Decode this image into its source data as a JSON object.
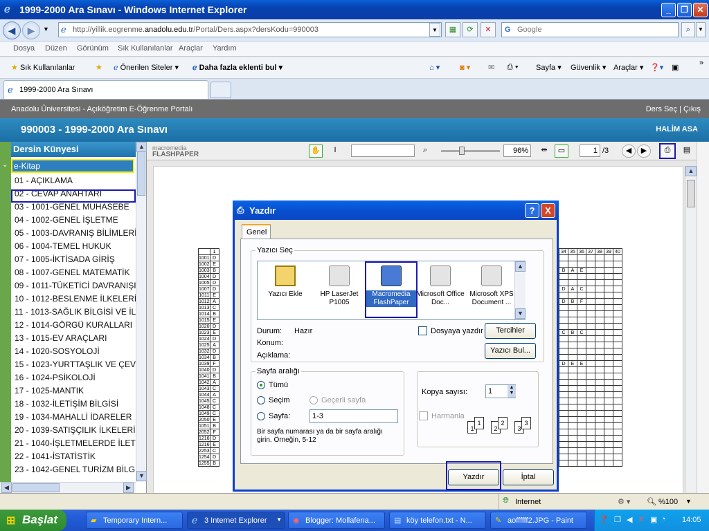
{
  "window": {
    "title": "1999-2000 Ara Sınavı - Windows Internet Explorer"
  },
  "address": {
    "url_prefix": "http://yillik.eogrenme.",
    "url_domain": "anadolu.edu.tr",
    "url_suffix": "/Portal/Ders.aspx?dersKodu=990003",
    "search_placeholder": "Google"
  },
  "menu": [
    "Dosya",
    "Düzen",
    "Görünüm",
    "Sık Kullanılanlar",
    "Araçlar",
    "Yardım"
  ],
  "favbar": {
    "favorites": "Sık Kullanılanlar",
    "suggested": "Önerilen Siteler",
    "addons": "Daha fazla eklenti bul",
    "page": "Sayfa",
    "security": "Güvenlik",
    "tools": "Araçlar"
  },
  "tabs": [
    {
      "label": "1999-2000 Ara Sınavı"
    }
  ],
  "portal": {
    "title": "Anadolu Üniversitesi - Açıköğretim E-Öğrenme Portalı",
    "links": "Ders Seç | Çıkış",
    "course_title": "990003 - 1999-2000 Ara Sınavı",
    "user": "HALİM ASA"
  },
  "sidebar": {
    "header": "Dersin Künyesi",
    "ekitap": "e-Kitap",
    "items": [
      "01 - AÇIKLAMA",
      "02 - CEVAP ANAHTARI",
      "03 - 1001-GENEL MUHASEBE",
      "04 - 1002-GENEL İŞLETME",
      "05 - 1003-DAVRANIŞ BİLİMLERİ",
      "06 - 1004-TEMEL HUKUK",
      "07 - 1005-İKTİSADA GİRİŞ",
      "08 - 1007-GENEL MATEMATİK",
      "09 - 1011-TÜKETİCİ DAVRANIŞI",
      "10 - 1012-BESLENME İLKELERİ",
      "11 - 1013-SAĞLIK BİLGİSİ VE İL",
      "12 - 1014-GÖRGÜ KURALLARI",
      "13 - 1015-EV ARAÇLARI",
      "14 - 1020-SOSYOLOJİ",
      "15 - 1023-YURTTAŞLIK VE ÇEV",
      "16 - 1024-PSİKOLOJİ",
      "17 - 1025-MANTIK",
      "18 - 1032-İLETİŞİM BİLGİSİ",
      "19 - 1034-MAHALLİ İDARELER",
      "20 - 1039-SATIŞÇILIK İLKELERİ",
      "21 - 1040-İŞLETMELERDE İLET",
      "22 - 1041-İSTATİSTİK",
      "23 - 1042-GENEL TURİZM BİLG"
    ]
  },
  "flashpaper": {
    "logo_top": "macromedia",
    "logo_bottom": "FLASHPAPER",
    "zoom": "96%",
    "page": "1",
    "pages": "/3"
  },
  "doc": {
    "header_cols": [
      "34",
      "35",
      "36",
      "37",
      "38",
      "39",
      "40"
    ],
    "row_codes": [
      "1001",
      "1002",
      "1003",
      "1004",
      "1005",
      "1007",
      "1011",
      "1012",
      "1013",
      "1014",
      "1015",
      "1020",
      "1023",
      "1024",
      "1025",
      "1032",
      "1034",
      "1039",
      "1040",
      "1041",
      "1042",
      "1043",
      "1044",
      "1045",
      "1048",
      "1049",
      "2050",
      "1051",
      "2052",
      "1216",
      "1216",
      "2253",
      "1254",
      "1255"
    ],
    "row_keys": [
      "D",
      "E",
      "B",
      "D",
      "D",
      "D",
      "E",
      "A",
      "C",
      "B",
      "E",
      "D",
      "E",
      "D",
      "A",
      "D",
      "B",
      "F",
      "D",
      "B",
      "A",
      "C",
      "A",
      "C",
      "C",
      "C",
      "E",
      "B",
      "F",
      "D",
      "E",
      "C",
      "D",
      "B"
    ],
    "answers_right": [
      [
        "B",
        "A",
        "E"
      ],
      [
        "D",
        "A",
        "C"
      ],
      [
        "D",
        "B",
        "F"
      ],
      [
        "C",
        "B",
        "C"
      ],
      [
        "D",
        "E",
        "E"
      ]
    ]
  },
  "dialog": {
    "title": "Yazdır",
    "help": "?",
    "close": "X",
    "tab": "Genel",
    "printer_group": "Yazıcı Seç",
    "printers": [
      {
        "name": "Yazıcı Ekle",
        "icon": "add-printer-icon"
      },
      {
        "name": "HP LaserJet P1005",
        "icon": "printer-icon"
      },
      {
        "name": "Macromedia FlashPaper",
        "icon": "printer-icon"
      },
      {
        "name": "Microsoft Office Doc...",
        "icon": "printer-icon"
      },
      {
        "name": "Microsoft XPS Document ...",
        "icon": "printer-icon"
      }
    ],
    "status_label": "Durum:",
    "status_value": "Hazır",
    "location_label": "Konum:",
    "comment_label": "Açıklama:",
    "print_to_file": "Dosyaya yazdır",
    "prefs_button": "Tercihler",
    "find_button": "Yazıcı Bul...",
    "range_group": "Sayfa aralığı",
    "range_all": "Tümü",
    "range_selection": "Seçim",
    "range_current": "Geçerli sayfa",
    "range_pages": "Sayfa:",
    "range_pages_value": "1-3",
    "range_hint": "Bir sayfa numarası ya da bir sayfa aralığı girin.  Örneğin, 5-12",
    "copies_label": "Kopya sayısı:",
    "copies_value": "1",
    "collate": "Harmanla",
    "collate_nums": [
      "1",
      "1",
      "2",
      "2",
      "3",
      "3"
    ],
    "print_button": "Yazdır",
    "cancel_button": "İptal"
  },
  "status": {
    "zone": "Internet",
    "zoom": "%100"
  },
  "taskbar": {
    "start": "Başlat",
    "tasks": [
      "Temporary Intern...",
      "3 Internet Explorer",
      "Blogger: Mollafena...",
      "köy telefon.txt - N...",
      "aoffffff2.JPG - Paint"
    ],
    "clock": "14:05"
  },
  "colors": {
    "title_blue": "#0a5fd8",
    "highlight": "#1a1ab4",
    "ekitap_border": "#f5f000",
    "sidebar_green": "#6aa64a"
  }
}
